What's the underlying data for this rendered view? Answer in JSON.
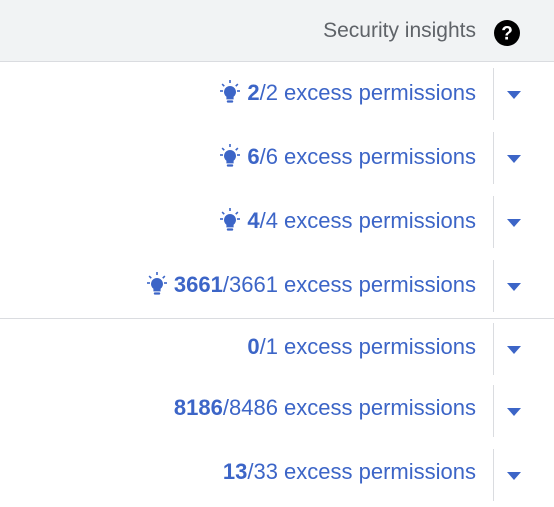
{
  "header": {
    "title": "Security insights",
    "help_icon": "help-circle-icon"
  },
  "colors": {
    "link": "#3c65c7",
    "header_bg": "#f1f3f4",
    "header_text": "#5f6368",
    "divider": "#dadce0"
  },
  "rows": [
    {
      "bulb": true,
      "num": "2",
      "rest": "/2 excess permissions",
      "icon": "lightbulb-icon"
    },
    {
      "bulb": true,
      "num": "6",
      "rest": "/6 excess permissions",
      "icon": "lightbulb-icon"
    },
    {
      "bulb": true,
      "num": "4",
      "rest": "/4 excess permissions",
      "icon": "lightbulb-icon"
    },
    {
      "bulb": true,
      "num": "3661",
      "rest": "/3661 excess permissions",
      "icon": "lightbulb-icon"
    },
    {
      "bulb": false,
      "num": "0",
      "rest": "/1 excess permissions"
    },
    {
      "bulb": false,
      "num": "8186",
      "rest": "/8486 excess permissions"
    },
    {
      "bulb": false,
      "num": "13",
      "rest": "/33 excess permissions"
    }
  ]
}
